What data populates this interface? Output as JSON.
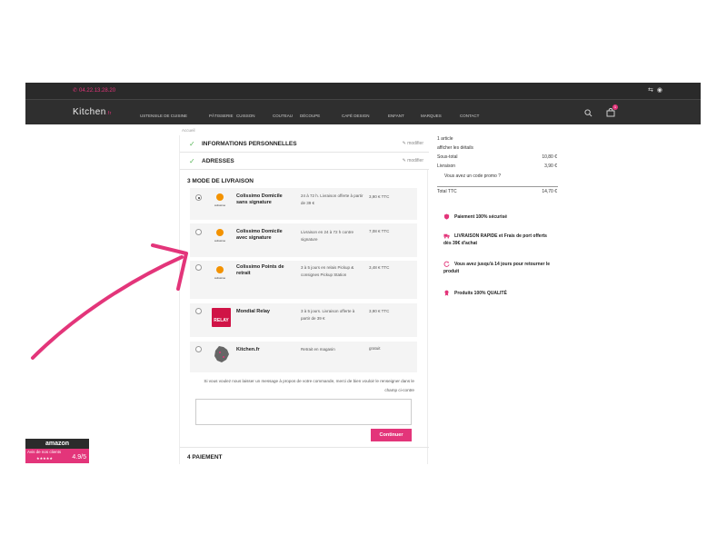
{
  "header": {
    "phone": "04.22.13.28.20",
    "logo_text": "Kitchen",
    "logo_suffix": ".fr",
    "nav": [
      "USTENSILE DE CUISINE",
      "PÂTISSERIE",
      "CUISSON",
      "COUTEAU",
      "DÉCOUPE",
      "CAFÉ DESIGN",
      "ENFANT",
      "MARQUES",
      "CONTACT"
    ],
    "cart_count": "1"
  },
  "breadcrumb": "Accueil",
  "checkout": {
    "steps_done": [
      {
        "title": "INFORMATIONS PERSONNELLES",
        "modify": "modifier"
      },
      {
        "title": "ADRESSES",
        "modify": "modifier"
      }
    ],
    "delivery_title": "3  MODE DE LIVRAISON",
    "carriers": [
      {
        "name": "Colissimo Domicile sans signature",
        "delay": "24 à 72 h. Livraison offerte à partir de 39 €",
        "price": "3,90 € TTC",
        "checked": true,
        "logo_label": "colissimo"
      },
      {
        "name": "Colissimo Domicile avec signature",
        "delay": "Livraison en 24 à 72 h contre signature",
        "price": "7,08 € TTC",
        "checked": false,
        "logo_label": "colissimo"
      },
      {
        "name": "Colissimo Points de retrait",
        "delay": "3 à 5 jours en relais Pickup & consignes Pickup Station",
        "price": "3,48 € TTC",
        "checked": false,
        "logo_label": "colissimo"
      },
      {
        "name": "Mondial Relay",
        "delay": "3 à 5 jours. Livraison offerte à partir de 39 €",
        "price": "3,90 € TTC",
        "checked": false,
        "logo_label": "RELAY"
      },
      {
        "name": "Kitchen.fr",
        "delay": "Retrait en magasin",
        "price": "gratuit",
        "checked": false,
        "logo_label": ""
      }
    ],
    "message_label": "Si vous voulez nous laisser un message à propos de votre commande, merci de bien vouloir le renseigner dans le champ ci-contre",
    "continue": "Continuer",
    "payment_title": "4  PAIEMENT"
  },
  "summary": {
    "article_count": "1 article",
    "details": "afficher les détails",
    "subtotal_label": "Sous-total",
    "subtotal": "10,80 €",
    "shipping_label": "Livraison",
    "shipping": "3,90 €",
    "promo": "Vous avez un code promo ?",
    "total_label": "Total TTC",
    "total": "14,70 €"
  },
  "reassurance": [
    "Paiement 100% sécurisé",
    "LIVRAISON RAPIDE et Frais de port offerts dès 39€ d'achat",
    "Vous avez jusqu'à 14 jours pour retourner le produit",
    "Produits 100% QUALITÉ"
  ],
  "amazon": {
    "brand": "amazon",
    "label": "Avis de nos clients",
    "stars": "★★★★★",
    "score": "4.9/5"
  },
  "colors": {
    "accent": "#e3357a",
    "header": "#2a2a2a",
    "check": "#5cb85c"
  }
}
